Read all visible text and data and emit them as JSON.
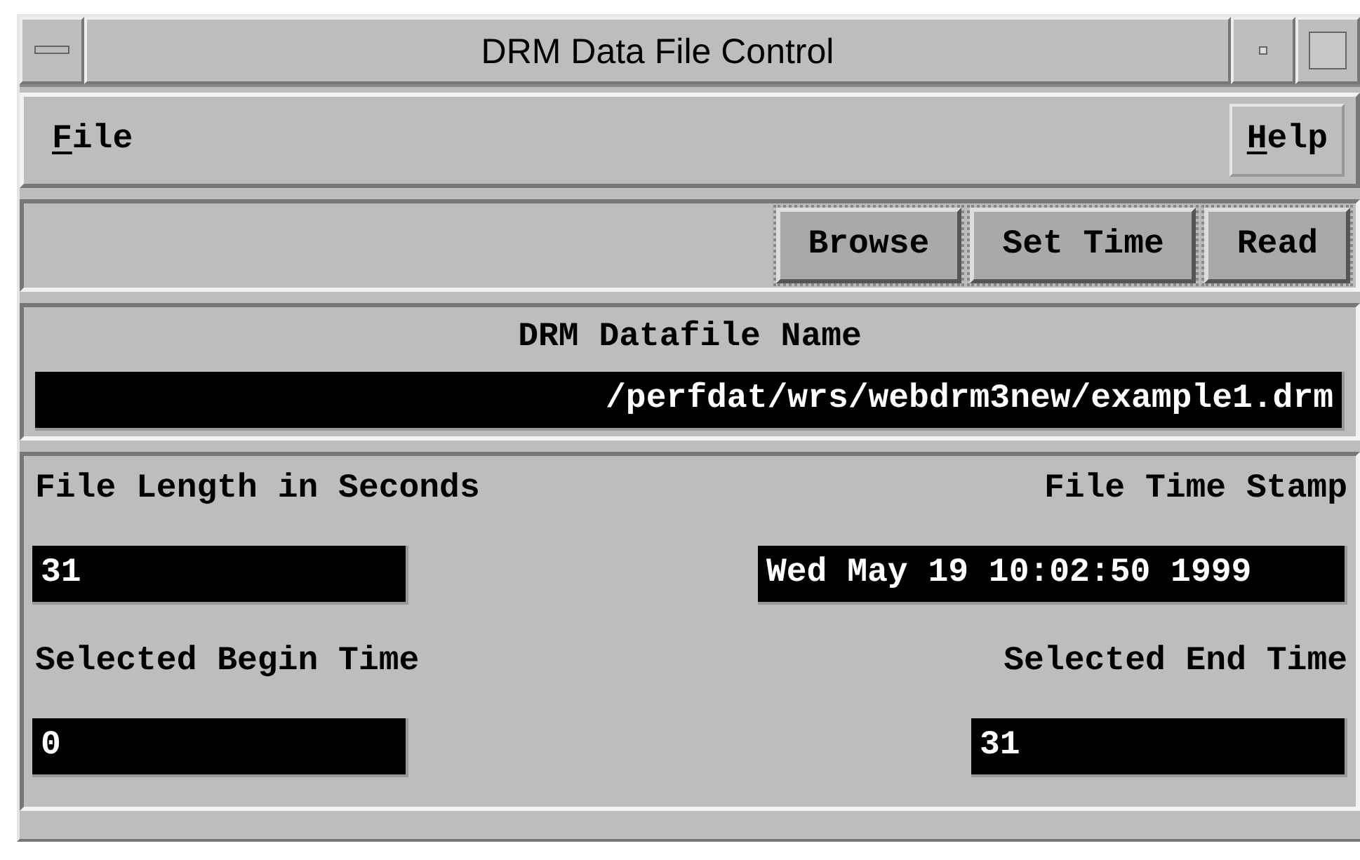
{
  "window": {
    "title": "DRM Data File Control"
  },
  "menu": [
    {
      "label": "File",
      "mnemonic_underlined": true
    },
    {
      "label": "Help",
      "mnemonic_underlined": true
    }
  ],
  "toolbar": {
    "buttons": [
      "Browse",
      "Set Time",
      "Read"
    ]
  },
  "datafile": {
    "label": "DRM Datafile Name",
    "value": "/perfdat/wrs/webdrm3new/example1.drm"
  },
  "fields": [
    {
      "label": "File Length in Seconds",
      "value": "31"
    },
    {
      "label": "File Time Stamp",
      "value": "Wed May 19 10:02:50 1999"
    },
    {
      "label": "Selected Begin Time",
      "value": "0"
    },
    {
      "label": "Selected End Time",
      "value": "31"
    }
  ]
}
